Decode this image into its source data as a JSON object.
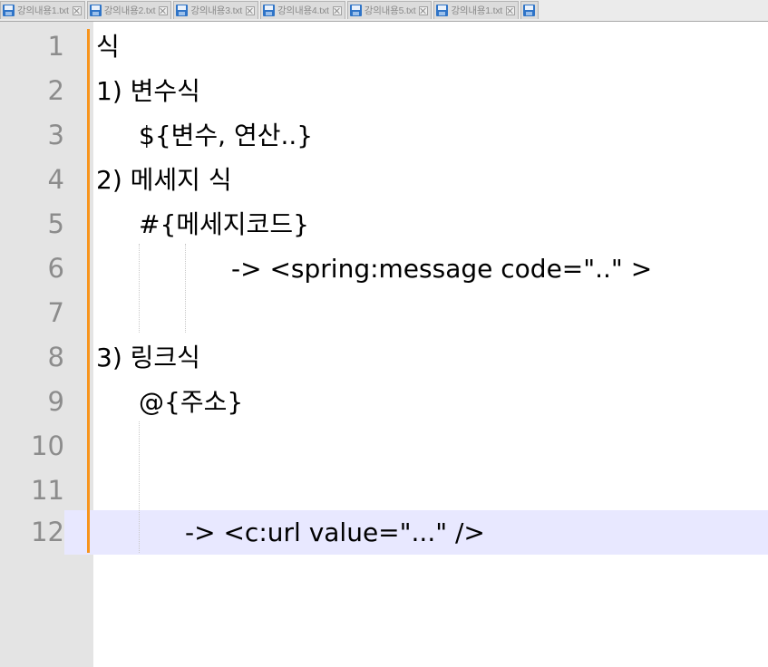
{
  "tabs": [
    {
      "name": "강의내용1.txt"
    },
    {
      "name": "강의내용2.txt"
    },
    {
      "name": "강의내용3.txt"
    },
    {
      "name": "강의내용4.txt"
    },
    {
      "name": "강의내용5.txt"
    },
    {
      "name": "강의내용1.txt"
    }
  ],
  "editor": {
    "current_line": 12,
    "lines": [
      {
        "num": "1",
        "text": "식"
      },
      {
        "num": "2",
        "text": "1) 변수식"
      },
      {
        "num": "3",
        "text": "${변수, 연산..}"
      },
      {
        "num": "4",
        "text": "2) 메세지 식"
      },
      {
        "num": "5",
        "text": "#{메세지코드}"
      },
      {
        "num": "6",
        "text": "-> <spring:message code=\"..\" >"
      },
      {
        "num": "7",
        "text": ""
      },
      {
        "num": "8",
        "text": "3) 링크식"
      },
      {
        "num": "9",
        "text": "@{주소}"
      },
      {
        "num": "10",
        "text": ""
      },
      {
        "num": "11",
        "text": ""
      },
      {
        "num": "12",
        "text": "-> <c:url value=\"...\" />"
      }
    ]
  },
  "colors": {
    "change_marker": "#f7941d",
    "current_line_highlight": "#e8e8ff",
    "gutter": "#e4e4e4",
    "line_number": "#8c8c8c"
  }
}
